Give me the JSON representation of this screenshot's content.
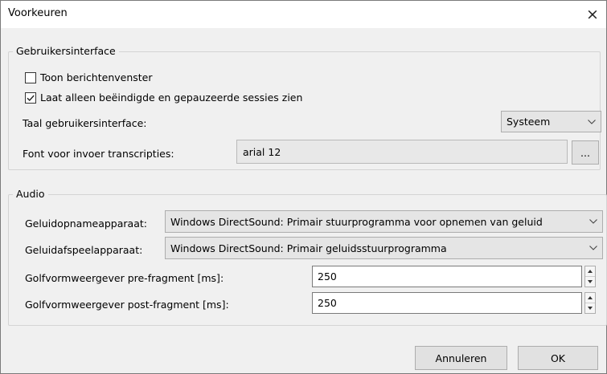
{
  "window": {
    "title": "Voorkeuren",
    "close_glyph": "×"
  },
  "ui_group": {
    "legend": "Gebruikersinterface",
    "show_messages": {
      "label": "Toon berichtenvenster",
      "checked": false
    },
    "show_finished": {
      "label": "Laat alleen beëindigde en gepauzeerde sessies zien",
      "checked": true
    },
    "language_label": "Taal gebruikersinterface:",
    "language_value": "Systeem",
    "font_label": "Font voor invoer transcripties:",
    "font_value": "arial 12",
    "browse_label": "..."
  },
  "audio_group": {
    "legend": "Audio",
    "record_label": "Geluidopnameapparaat:",
    "record_value": "Windows DirectSound: Primair stuurprogramma voor opnemen van geluid",
    "play_label": "Geluidafspeelapparaat:",
    "play_value": "Windows DirectSound: Primair geluidsstuurprogramma",
    "pre_label": "Golfvormweergever pre-fragment [ms]:",
    "pre_value": "250",
    "post_label": "Golfvormweergever post-fragment [ms]:",
    "post_value": "250"
  },
  "footer": {
    "cancel_label": "Annuleren",
    "ok_label": "OK"
  },
  "icons": [
    "close-icon",
    "check-icon",
    "chevron-down-icon",
    "spin-up-icon",
    "spin-down-icon"
  ]
}
